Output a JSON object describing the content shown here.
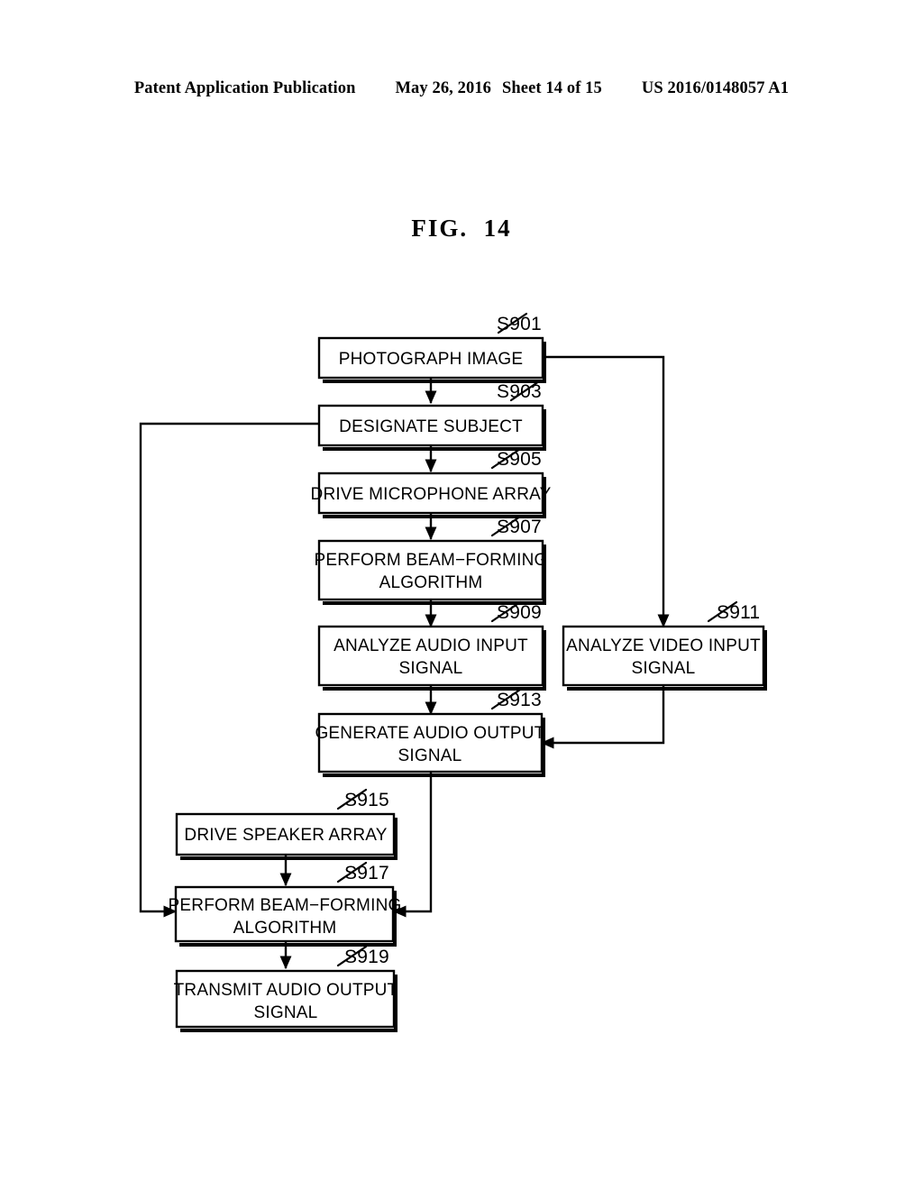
{
  "header": {
    "publication": "Patent Application Publication",
    "date": "May 26, 2016",
    "sheet": "Sheet 14 of 15",
    "document_number": "US 2016/0148057 A1"
  },
  "figure": {
    "caption": "FIG.  14"
  },
  "diagram": {
    "type": "flowchart",
    "steps": [
      {
        "id": "S901",
        "label_line1": "PHOTOGRAPH IMAGE",
        "label_line2": ""
      },
      {
        "id": "S903",
        "label_line1": "DESIGNATE SUBJECT",
        "label_line2": ""
      },
      {
        "id": "S905",
        "label_line1": "DRIVE MICROPHONE ARRAY",
        "label_line2": ""
      },
      {
        "id": "S907",
        "label_line1": "PERFORM BEAM−FORMING",
        "label_line2": "ALGORITHM"
      },
      {
        "id": "S909",
        "label_line1": "ANALYZE AUDIO INPUT",
        "label_line2": "SIGNAL"
      },
      {
        "id": "S911",
        "label_line1": "ANALYZE VIDEO INPUT",
        "label_line2": "SIGNAL"
      },
      {
        "id": "S913",
        "label_line1": "GENERATE AUDIO OUTPUT",
        "label_line2": "SIGNAL"
      },
      {
        "id": "S915",
        "label_line1": "DRIVE SPEAKER ARRAY",
        "label_line2": ""
      },
      {
        "id": "S917",
        "label_line1": "PERFORM BEAM−FORMING",
        "label_line2": "ALGORITHM"
      },
      {
        "id": "S919",
        "label_line1": "TRANSMIT AUDIO OUTPUT",
        "label_line2": "SIGNAL"
      }
    ],
    "connections": [
      {
        "from": "S901",
        "to": "S903"
      },
      {
        "from": "S903",
        "to": "S905"
      },
      {
        "from": "S905",
        "to": "S907"
      },
      {
        "from": "S907",
        "to": "S909"
      },
      {
        "from": "S909",
        "to": "S913"
      },
      {
        "from": "S901",
        "to": "S911"
      },
      {
        "from": "S911",
        "to": "S913"
      },
      {
        "from": "S913",
        "to": "S915"
      },
      {
        "from": "S915",
        "to": "S917"
      },
      {
        "from": "S913",
        "to": "S917"
      },
      {
        "from": "S903",
        "to": "S917"
      },
      {
        "from": "S917",
        "to": "S919"
      }
    ],
    "colors": {
      "line": "#000000",
      "box_fill": "#ffffff",
      "background": "#ffffff"
    }
  }
}
